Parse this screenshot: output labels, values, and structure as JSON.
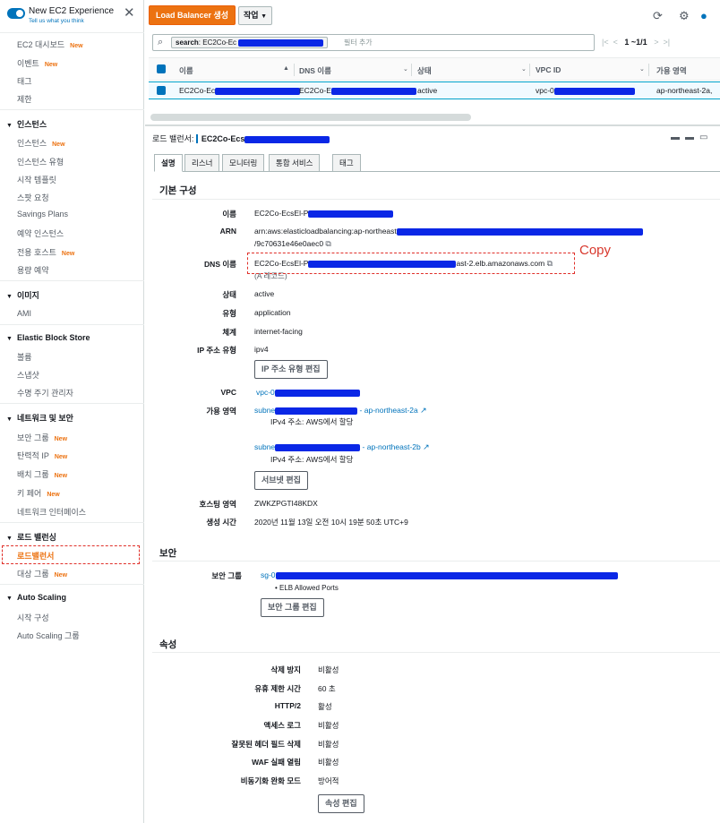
{
  "sidebar": {
    "experience_title": "New EC2 Experience",
    "experience_sub": "Tell us what you think",
    "top_items": [
      {
        "label": "EC2 대시보드",
        "new": "New"
      },
      {
        "label": "이벤트",
        "new": "New"
      },
      {
        "label": "태그",
        "new": ""
      },
      {
        "label": "제한",
        "new": ""
      }
    ],
    "sections": [
      {
        "title": "인스턴스",
        "items": [
          {
            "label": "인스턴스",
            "new": "New"
          },
          {
            "label": "인스턴스 유형",
            "new": ""
          },
          {
            "label": "시작 템플릿",
            "new": ""
          },
          {
            "label": "스팟 요청",
            "new": ""
          },
          {
            "label": "Savings Plans",
            "new": ""
          },
          {
            "label": "예약 인스턴스",
            "new": ""
          },
          {
            "label": "전용 호스트",
            "new": "New"
          },
          {
            "label": "용량 예약",
            "new": ""
          }
        ]
      },
      {
        "title": "이미지",
        "items": [
          {
            "label": "AMI",
            "new": ""
          }
        ]
      },
      {
        "title": "Elastic Block Store",
        "items": [
          {
            "label": "볼륨",
            "new": ""
          },
          {
            "label": "스냅샷",
            "new": ""
          },
          {
            "label": "수명 주기 관리자",
            "new": ""
          }
        ]
      },
      {
        "title": "네트워크 및 보안",
        "items": [
          {
            "label": "보안 그룹",
            "new": "New"
          },
          {
            "label": "탄력적 IP",
            "new": "New"
          },
          {
            "label": "배치 그룹",
            "new": "New"
          },
          {
            "label": "키 페어",
            "new": "New"
          },
          {
            "label": "네트워크 인터페이스",
            "new": ""
          }
        ]
      },
      {
        "title": "로드 밸런싱",
        "items": [
          {
            "label": "로드밸런서",
            "new": ""
          },
          {
            "label": "대상 그룹",
            "new": "New"
          }
        ]
      },
      {
        "title": "Auto Scaling",
        "items": [
          {
            "label": "시작 구성",
            "new": ""
          },
          {
            "label": "Auto Scaling 그룹",
            "new": ""
          }
        ]
      }
    ]
  },
  "toolbar": {
    "create_lb": "Load Balancer 생성",
    "actions": "작업",
    "search_key": "search",
    "search_value": ": EC2Co-Ec",
    "filter_placeholder": "필터 추가",
    "pager": "1 ~1/1"
  },
  "table": {
    "headers": [
      "이름",
      "DNS 이름",
      "상태",
      "VPC ID",
      "가용 영역"
    ],
    "row": {
      "name": "EC2Co-Ec",
      "dns": "EC2Co-E",
      "state": "active",
      "vpc": "vpc-0",
      "az": "ap-northeast-2a,"
    }
  },
  "detail": {
    "title_label": "로드 밸런서:",
    "title_value": "EC2Co-Ecs",
    "tabs": [
      "설명",
      "리스너",
      "모니터링",
      "통합 서비스",
      "태그"
    ],
    "basic": {
      "section": "기본 구성",
      "name_label": "이름",
      "name_value": "EC2Co-EcsEl-P",
      "arn_label": "ARN",
      "arn_value": "arn:aws:elasticloadbalancing:ap-northeast",
      "arn_value2": "/9c70631e46e0aec0",
      "dns_label": "DNS 이름",
      "dns_prefix": "EC2Co-EcsEl-P",
      "dns_suffix": "ast-2.elb.amazonaws.com",
      "dns_record": "(A 레코드)",
      "state_label": "상태",
      "state_value": "active",
      "type_label": "유형",
      "type_value": "application",
      "scheme_label": "체계",
      "scheme_value": "internet-facing",
      "ip_label": "IP 주소 유형",
      "ip_value": "ipv4",
      "ip_button": "IP 주소 유형 편집",
      "vpc_label": "VPC",
      "vpc_value": "vpc-0",
      "az_label": "가용 영역",
      "subnet_a_prefix": "subne",
      "subnet_a_suffix": "- ap-northeast-2a",
      "subnet_a_ip": "IPv4 주소: AWS에서 할당",
      "subnet_b_prefix": "subne",
      "subnet_b_suffix": "- ap-northeast-2b",
      "subnet_b_ip": "IPv4 주소: AWS에서 할당",
      "subnet_button": "서브넷 편집",
      "zone_label": "호스팅 영역",
      "zone_value": "ZWKZPGTI48KDX",
      "created_label": "생성 시간",
      "created_value": "2020년 11월 13일 오전 10시 19분 50초 UTC+9"
    },
    "security": {
      "section": "보안",
      "sg_label": "보안 그룹",
      "sg_value": "sg-0",
      "sg_name": "• ELB Allowed Ports",
      "sg_button": "보안 그룹 편집"
    },
    "attributes": {
      "section": "속성",
      "rows": [
        {
          "label": "삭제 방지",
          "value": "비활성"
        },
        {
          "label": "유휴 제한 시간",
          "value": "60 초"
        },
        {
          "label": "HTTP/2",
          "value": "활성"
        },
        {
          "label": "액세스 로그",
          "value": "비활성"
        },
        {
          "label": "잘못된 헤더 필드 삭제",
          "value": "비활성"
        },
        {
          "label": "WAF 실패 열림",
          "value": "비활성"
        },
        {
          "label": "비동기화 완화 모드",
          "value": "방어적"
        }
      ],
      "button": "속성 편집"
    }
  },
  "annotation": {
    "copy_label": "Copy",
    "color": "#d8382d"
  },
  "colors": {
    "accent": "#ec7211",
    "link": "#0073bb",
    "redaction": "#0a27e6"
  }
}
